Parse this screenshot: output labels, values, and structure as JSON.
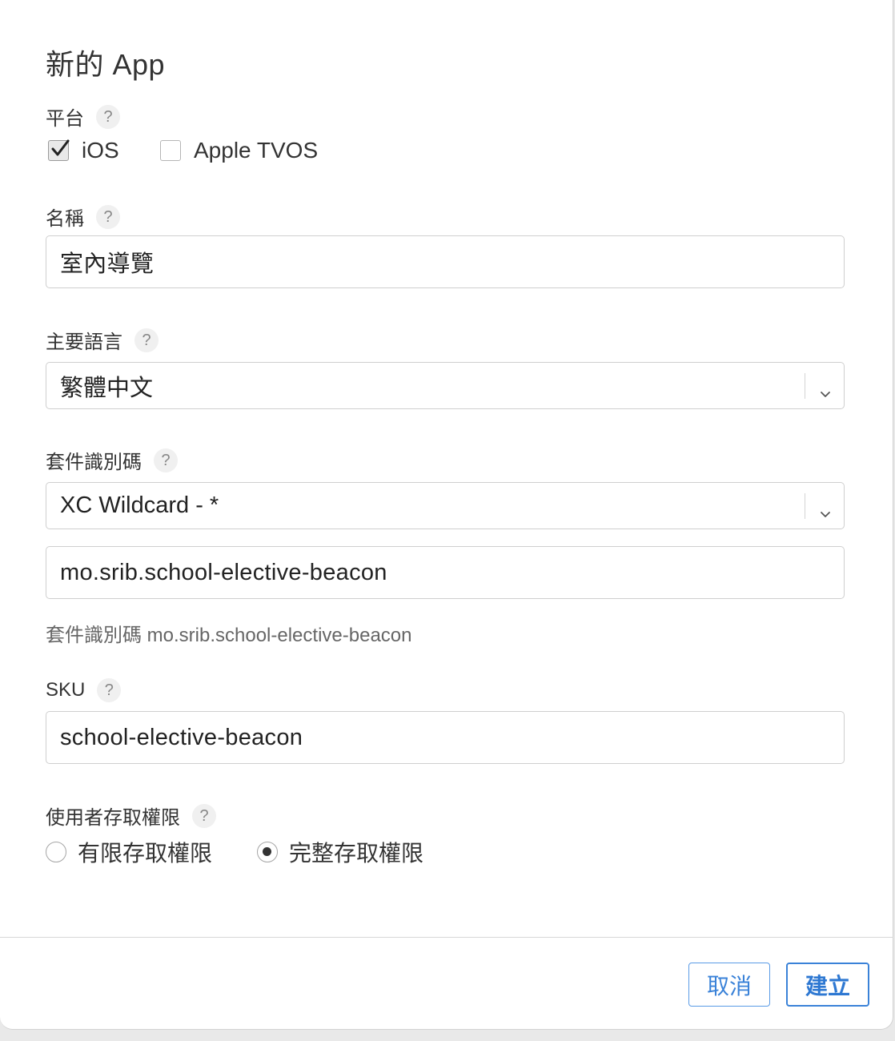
{
  "dialog": {
    "title": "新的 App"
  },
  "platform": {
    "label": "平台",
    "help": "?",
    "options": [
      {
        "label": "iOS",
        "checked": true
      },
      {
        "label": "Apple TVOS",
        "checked": false
      }
    ]
  },
  "name": {
    "label": "名稱",
    "help": "?",
    "value": "室內導覽"
  },
  "primary_language": {
    "label": "主要語言",
    "help": "?",
    "selected": "繁體中文"
  },
  "bundle_id": {
    "label": "套件識別碼",
    "help": "?",
    "selected": "XC Wildcard - *",
    "suffix_value": "mo.srib.school-elective-beacon",
    "hint": "套件識別碼 mo.srib.school-elective-beacon"
  },
  "sku": {
    "label": "SKU",
    "help": "?",
    "value": "school-elective-beacon"
  },
  "user_access": {
    "label": "使用者存取權限",
    "help": "?",
    "options": [
      {
        "label": "有限存取權限",
        "selected": false
      },
      {
        "label": "完整存取權限",
        "selected": true
      }
    ]
  },
  "footer": {
    "cancel_label": "取消",
    "create_label": "建立"
  },
  "colors": {
    "accent": "#3a82d8",
    "border": "#cfcfcf"
  }
}
